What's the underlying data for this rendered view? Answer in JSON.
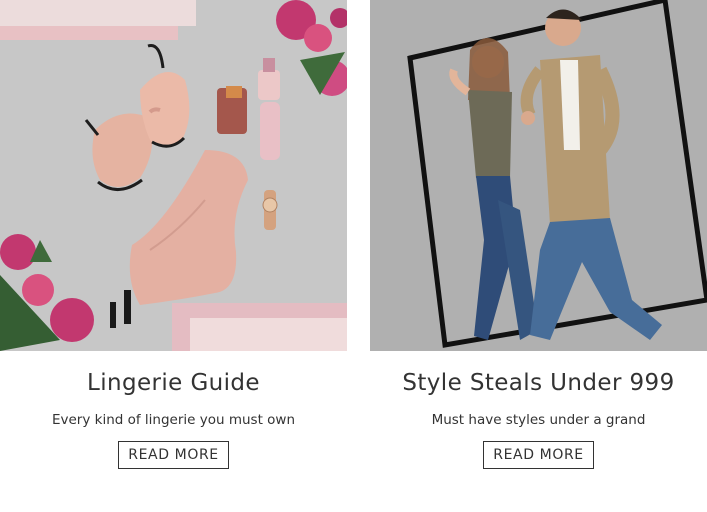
{
  "cards": [
    {
      "title": "Lingerie Guide",
      "description": "Every kind of lingerie you must own",
      "button_label": "READ MORE",
      "image_name": "lingerie-flatlay-image"
    },
    {
      "title": "Style Steals Under 999",
      "description": "Must have styles under a grand",
      "button_label": "READ MORE",
      "image_name": "couple-jumping-image"
    }
  ],
  "colors": {
    "text": "#333333",
    "lingerie_bg": "#c6c6c6",
    "blush_pink": "#e9b9b0",
    "peony": "#c2386f"
  }
}
